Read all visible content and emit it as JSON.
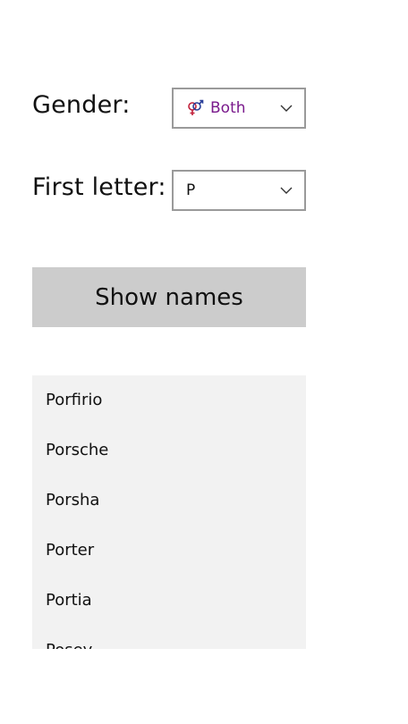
{
  "gender": {
    "label": "Gender:",
    "selected": "Both",
    "selected_color": "#7a1a8c",
    "icon": "male-female-icon"
  },
  "first_letter": {
    "label": "First letter:",
    "selected": "P"
  },
  "show_button": {
    "label": "Show names"
  },
  "names": [
    "Porfirio",
    "Porsche",
    "Porsha",
    "Porter",
    "Portia",
    "Posey"
  ],
  "colors": {
    "dropdown_border": "#9a9a9a",
    "button_bg": "#cccccc",
    "list_bg": "#f2f2f2",
    "male_symbol": "#2a3f9a",
    "female_symbol": "#c0203a"
  }
}
